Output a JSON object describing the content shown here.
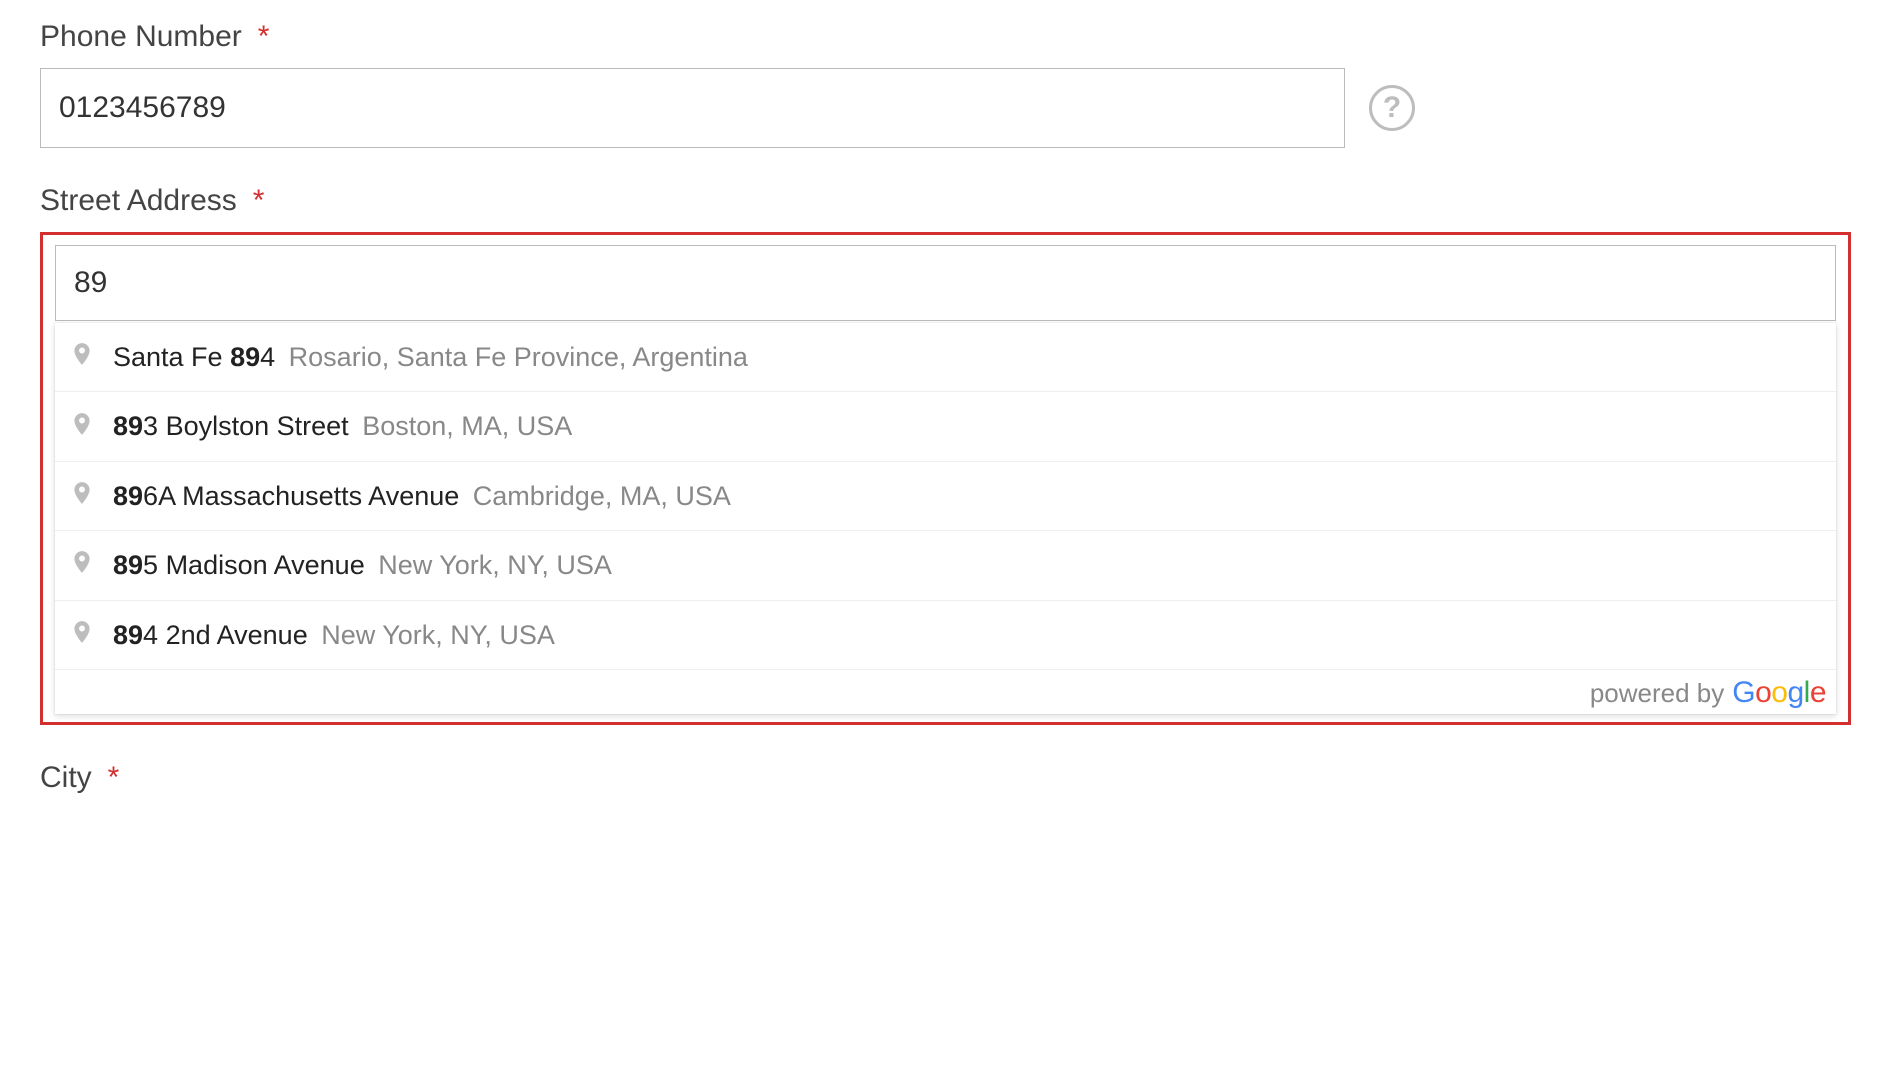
{
  "fields": {
    "phone": {
      "label": "Phone Number",
      "required_marker": "*",
      "value": "0123456789"
    },
    "street": {
      "label": "Street Address",
      "required_marker": "*",
      "value": "89"
    },
    "city": {
      "label": "City",
      "required_marker": "*"
    }
  },
  "help_glyph": "?",
  "autocomplete": {
    "suggestions": [
      {
        "pre": "Santa Fe ",
        "bold": "89",
        "post": "4",
        "secondary": "Rosario, Santa Fe Province, Argentina"
      },
      {
        "pre": "",
        "bold": "89",
        "post": "3 Boylston Street",
        "secondary": "Boston, MA, USA"
      },
      {
        "pre": "",
        "bold": "89",
        "post": "6A Massachusetts Avenue",
        "secondary": "Cambridge, MA, USA"
      },
      {
        "pre": "",
        "bold": "89",
        "post": "5 Madison Avenue",
        "secondary": "New York, NY, USA"
      },
      {
        "pre": "",
        "bold": "89",
        "post": "4 2nd Avenue",
        "secondary": "New York, NY, USA"
      }
    ],
    "powered_label": "powered by",
    "google": {
      "G": "G",
      "o1": "o",
      "o2": "o",
      "g": "g",
      "l": "l",
      "e": "e"
    }
  }
}
